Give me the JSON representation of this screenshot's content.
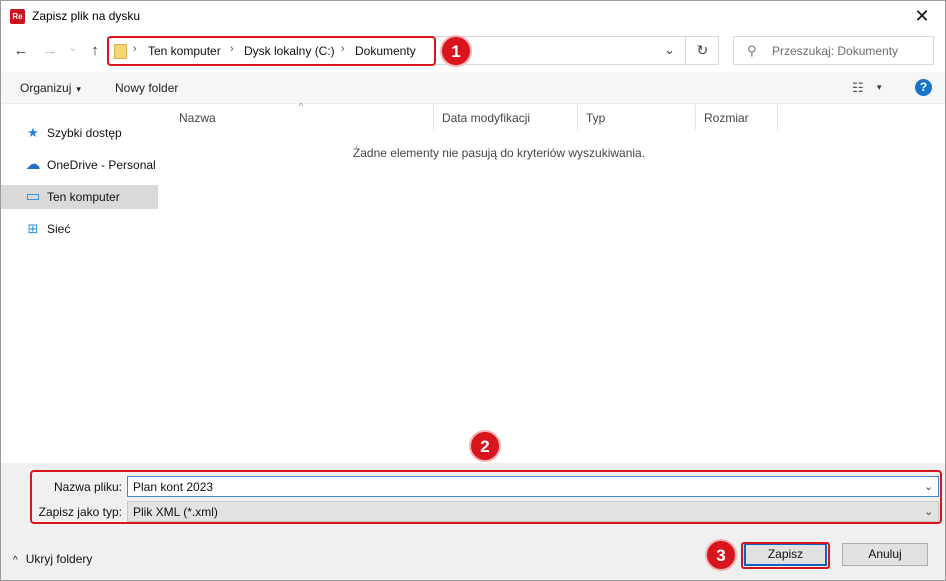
{
  "window": {
    "title": "Zapisz plik na dysku",
    "app_icon_text": "Re",
    "close_glyph": "✕"
  },
  "nav": {
    "back_glyph": "←",
    "forward_glyph": "→",
    "recent_glyph": "⌄",
    "up_glyph": "↑",
    "breadcrumbs": [
      "Ten komputer",
      "Dysk lokalny (C:)",
      "Dokumenty"
    ],
    "separator": "›",
    "dropdown_glyph": "⌄",
    "refresh_glyph": "↻",
    "search_placeholder": "Przeszukaj: Dokumenty",
    "search_glyph": "⚲"
  },
  "toolbar": {
    "organize_label": "Organizuj",
    "organize_caret": "▾",
    "new_folder_label": "Nowy folder",
    "view_glyph": "☷",
    "view_caret": "▾",
    "help_glyph": "?"
  },
  "sidebar": {
    "items": [
      {
        "label": "Szybki dostęp",
        "icon": "star-icon",
        "glyph": "★",
        "color": "#2b7fd6"
      },
      {
        "label": "OneDrive - Personal",
        "icon": "cloud-icon",
        "glyph": "☁",
        "color": "#1e6fc4"
      },
      {
        "label": "Ten komputer",
        "icon": "computer-icon",
        "glyph": "▭",
        "color": "#2a8fd9",
        "selected": true
      },
      {
        "label": "Sieć",
        "icon": "network-icon",
        "glyph": "⊞",
        "color": "#2a8fd9"
      }
    ]
  },
  "filelist": {
    "columns": [
      "Nazwa",
      "Data modyfikacji",
      "Typ",
      "Rozmiar"
    ],
    "sort_glyph": "^",
    "empty_message": "Żadne elementy nie pasują do kryteriów wyszukiwania."
  },
  "form": {
    "filename_label": "Nazwa pliku:",
    "filename_value": "Plan kont 2023",
    "filetype_label": "Zapisz jako typ:",
    "filetype_value": "Plik XML (*.xml)",
    "caret_glyph": "⌄"
  },
  "footer": {
    "hide_folders_label": "Ukryj foldery",
    "hide_folders_caret": "^",
    "save_label": "Zapisz",
    "cancel_label": "Anuluj"
  },
  "annotations": [
    "1",
    "2",
    "3"
  ],
  "colors": {
    "highlight": "#d8141c",
    "accent": "#0a64c8"
  }
}
